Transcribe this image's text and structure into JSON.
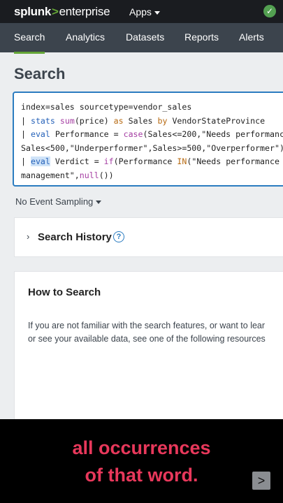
{
  "topbar": {
    "logo_main": "splunk",
    "logo_gt": ">",
    "logo_product": "enterprise",
    "apps_label": "Apps",
    "status_glyph": "✓"
  },
  "nav": {
    "tabs": [
      {
        "label": "Search",
        "active": true
      },
      {
        "label": "Analytics"
      },
      {
        "label": "Datasets"
      },
      {
        "label": "Reports"
      },
      {
        "label": "Alerts"
      }
    ]
  },
  "page": {
    "title": "Search"
  },
  "search": {
    "lines": [
      "index=sales sourcetype=vendor_sales",
      "| stats sum(price) as Sales by VendorStateProvince",
      "| eval Performance = case(Sales<=200,\"Needs performance",
      "Sales<500,\"Underperformer\",Sales>=500,\"Overperformer\")",
      "| eval Verdict = if(Performance IN(\"Needs performance a",
      "management\",null())"
    ]
  },
  "sampling": {
    "label": "No Event Sampling"
  },
  "history": {
    "title": "Search History",
    "help_glyph": "?",
    "chevron": "›"
  },
  "howto": {
    "title": "How to Search",
    "text_line1": "If you are not familiar with the search features, or want to lear",
    "text_line2": "or see your available data, see one of the following resources"
  },
  "caption": {
    "line1": "all occurrences",
    "line2": "of that word.",
    "next_glyph": ">"
  },
  "colors": {
    "accent_green": "#65a637",
    "focus_blue": "#2b7cc0",
    "caption_red": "#e8385b"
  }
}
